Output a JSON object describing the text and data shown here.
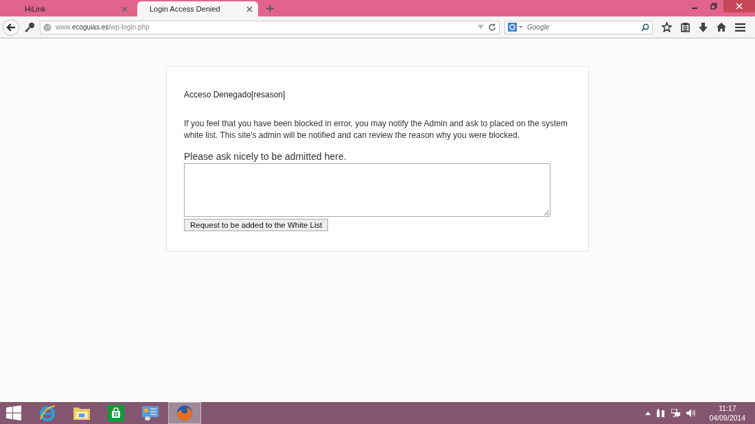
{
  "tabs": [
    {
      "label": "HiLink",
      "selected": false
    },
    {
      "label": "Login Access Denied",
      "selected": true
    }
  ],
  "address_bar": {
    "url": "www.**ecoguias.es**/wp-login.php"
  },
  "search": {
    "placeholder": "Google"
  },
  "page": {
    "heading": "Acceso Denegado[resason]",
    "message": "If you feel that you have been blocked in error, you may notify the Admin and ask to placed on the system white list. This site's admin will be notified and can review the reason why you were blocked.",
    "prompt": "Please ask nicely to be admitted here.",
    "button": "Request to be added to the White List"
  },
  "taskbar": {
    "apps": [
      {
        "kind": "ie",
        "selected": false
      },
      {
        "kind": "explorer",
        "selected": false
      },
      {
        "kind": "store",
        "selected": false
      },
      {
        "kind": "control",
        "selected": false
      },
      {
        "kind": "firefox",
        "selected": true
      }
    ],
    "time": "11:17",
    "date": "04/09/2014"
  }
}
